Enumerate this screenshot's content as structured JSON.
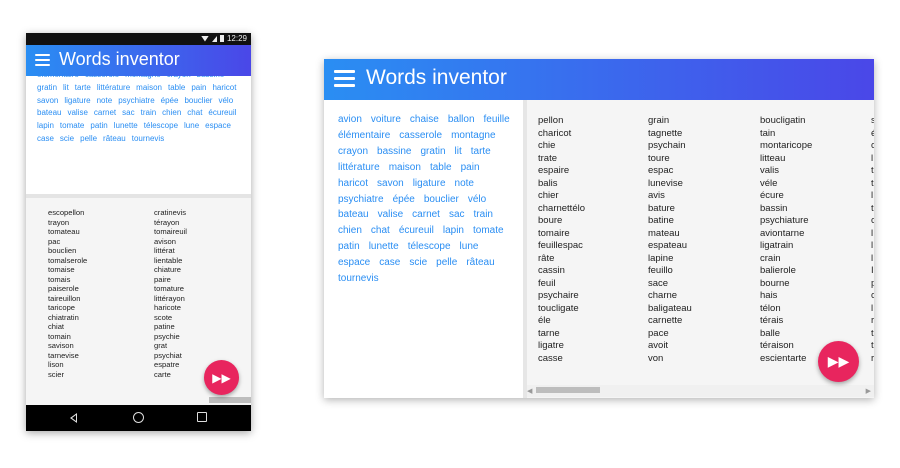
{
  "app_title": "Words inventor",
  "status_time": "12:29",
  "source_words": [
    "avion",
    "voiture",
    "chaise",
    "ballon",
    "feuille",
    "élémentaire",
    "casserole",
    "montagne",
    "crayon",
    "bassine",
    "gratin",
    "lit",
    "tarte",
    "littérature",
    "maison",
    "table",
    "pain",
    "haricot",
    "savon",
    "ligature",
    "note",
    "psychiatre",
    "épée",
    "bouclier",
    "vélo",
    "bateau",
    "valise",
    "carnet",
    "sac",
    "train",
    "chien",
    "chat",
    "écureuil",
    "lapin",
    "tomate",
    "patin",
    "lunette",
    "télescope",
    "lune",
    "espace",
    "case",
    "scie",
    "pelle",
    "râteau",
    "tournevis"
  ],
  "phone_source_visible": [
    "élémentaire",
    "casserole",
    "montagne",
    "crayon",
    "bassine",
    "gratin",
    "lit",
    "tarte",
    "littérature",
    "maison",
    "table",
    "pain",
    "haricot",
    "savon",
    "ligature",
    "note",
    "psychiatre",
    "épée",
    "bouclier",
    "vélo",
    "bateau",
    "valise",
    "carnet",
    "sac",
    "train",
    "chien",
    "chat",
    "écureuil",
    "lapin",
    "tomate",
    "patin",
    "lunette",
    "télescope",
    "lune",
    "espace",
    "case",
    "scie",
    "pelle",
    "râteau",
    "tournevis"
  ],
  "phone_generated": [
    [
      "escopellon",
      "trayon",
      "tomateau",
      "pac",
      "bouclien",
      "tomalserole",
      "tomaise",
      "tomais",
      "paiserole",
      "taireuillon",
      "taricope",
      "chiatratin",
      "chiat",
      "tomain",
      "savison",
      "tarnevise",
      "lison",
      "scier"
    ],
    [
      "cratinevis",
      "térayon",
      "tomaireuil",
      "avison",
      "littérat",
      "lientable",
      "chiature",
      "paire",
      "tomature",
      "littérayon",
      "haricote",
      "scote",
      "patine",
      "psychie",
      "grat",
      "psychiat",
      "espatre",
      "carte"
    ]
  ],
  "desktop_generated": [
    [
      "pellon",
      "charicot",
      "chie",
      "trate",
      "espaire",
      "balis",
      "chier",
      "charnettélo",
      "boure",
      "tomaire",
      "feuillespac",
      "râte",
      "cassin",
      "feuil",
      "psychaire",
      "toucligate",
      "éle",
      "tarne",
      "ligatre",
      "casse"
    ],
    [
      "grain",
      "tagnette",
      "psychain",
      "toure",
      "espac",
      "lunevise",
      "avis",
      "bature",
      "batine",
      "mateau",
      "espateau",
      "lapine",
      "feuillo",
      "sace",
      "charne",
      "baligateau",
      "carnette",
      "pace",
      "avoit",
      "von"
    ],
    [
      "boucligatin",
      "tain",
      "montaricope",
      "litteau",
      "valis",
      "véle",
      "écure",
      "bassin",
      "psychiature",
      "aviontarne",
      "ligatrain",
      "crain",
      "balierole",
      "bourne",
      "hais",
      "télon",
      "térais",
      "balle",
      "téraison",
      "escientarte"
    ],
    [
      "s",
      "é",
      "c",
      "l",
      "t",
      "t",
      "l",
      "t",
      "c",
      "l",
      "l",
      "l",
      "I",
      "p",
      "c",
      "l",
      "r",
      "t",
      "t",
      "r"
    ]
  ],
  "fab_icon": "fast-forward-icon",
  "colors": {
    "accent": "#e8255e",
    "appbar_start": "#2a8ef3",
    "appbar_end": "#4a47e8",
    "word_link": "#2a8ef3"
  }
}
